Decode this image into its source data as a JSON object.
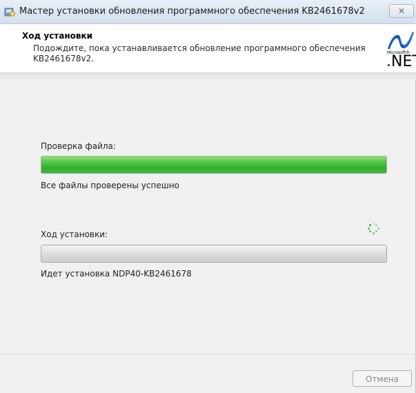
{
  "window": {
    "title": "Мастер установки обновления программного обеспечения KB2461678v2",
    "close_glyph": "✕"
  },
  "header": {
    "title": "Ход установки",
    "subtitle": "Подождите, пока устанавливается обновление программного обеспечения KB2461678v2.",
    "logo": {
      "small_text": "Microsoft®",
      "big_text": ".NET"
    }
  },
  "file_check": {
    "label": "Проверка файла:",
    "progress": 1.0,
    "status": "Все файлы проверены успешно"
  },
  "install": {
    "label": "Ход установки:",
    "progress": 0.0,
    "status": "Идет установка NDP40-KB2461678"
  },
  "buttons": {
    "cancel": "Отмена"
  },
  "colors": {
    "progress_fill": "#3fb839",
    "spinner": "#3aaa35",
    "accent": "#1a5bb5"
  },
  "icons": {
    "title_icon": "installer-icon",
    "spinner": "busy-spinner-icon",
    "logo": "dotnet-logo-icon"
  }
}
